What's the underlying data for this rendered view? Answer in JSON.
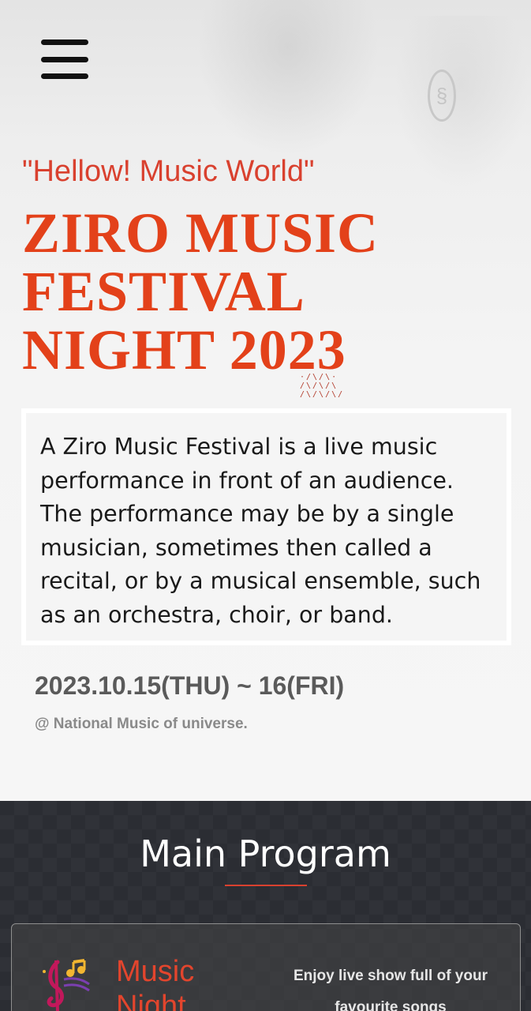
{
  "header": {
    "menu_icon": "hamburger-menu-icon"
  },
  "hero": {
    "tagline": "\"Hellow! Music World\"",
    "title_lines": [
      "ZIRO MUSIC",
      "FESTIVAL",
      "NIGHT 2023"
    ],
    "description": "A Ziro Music Festival is a live music performance in front of an audience. The performance may be by a single musician, sometimes then called a recital, or by a musical ensemble, such as an orchestra, choir, or band.",
    "dates": "2023.10.15(THU) ~ 16(FRI)",
    "venue": "@ National Music of universe."
  },
  "program": {
    "title": "Main Program",
    "cards": [
      {
        "icon": "music-notes-icon",
        "title": "Music Night",
        "description": "Enjoy live show full of your favourite songs"
      }
    ]
  },
  "colors": {
    "accent": "#e3411a",
    "dark_section": "#2b2d33",
    "text": "#1a1a1a"
  }
}
